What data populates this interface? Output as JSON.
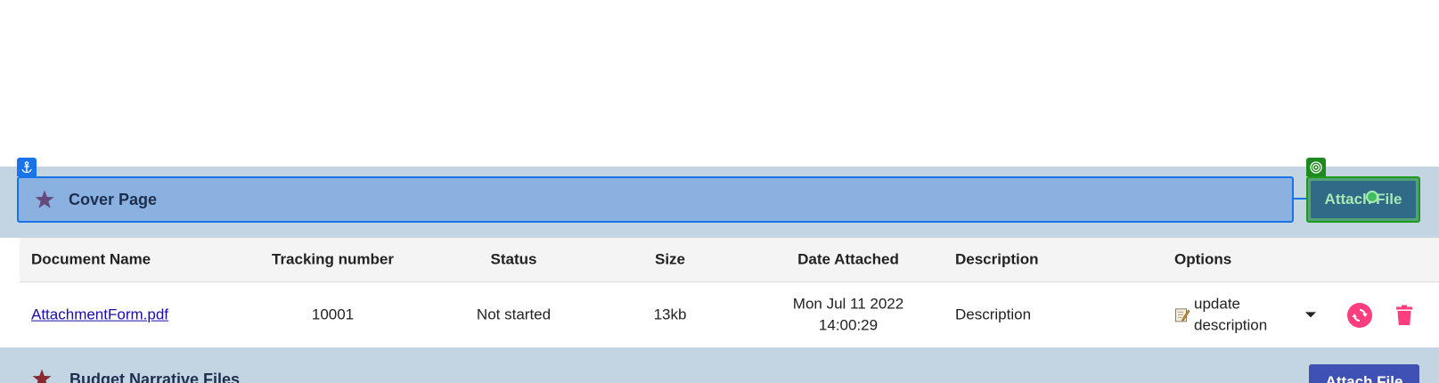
{
  "sections": [
    {
      "title": "Cover Page",
      "attach_label": "Attach File",
      "icons": {
        "anchor": "anchor-icon",
        "target": "target-icon",
        "star": "star-icon"
      }
    },
    {
      "title": "Budget Narrative Files",
      "attach_label": "Attach File"
    }
  ],
  "table": {
    "columns": [
      "Document Name",
      "Tracking number",
      "Status",
      "Size",
      "Date Attached",
      "Description",
      "Options"
    ],
    "rows": [
      {
        "document_name": "AttachmentForm.pdf",
        "tracking_number": "10001",
        "status": "Not started",
        "size": "13kb",
        "date_line1": "Mon Jul 11 2022",
        "date_line2": "14:00:29",
        "description": "Description",
        "option_line1": "update",
        "option_line2": "description"
      }
    ]
  },
  "colors": {
    "band": "#c3d5e2",
    "header_fill": "#8ab1df",
    "selection_blue": "#1a73e8",
    "drop_green": "#1c9a1c",
    "refresh_pink": "#ff3d7f",
    "attach_indigo": "#3f51b5"
  }
}
